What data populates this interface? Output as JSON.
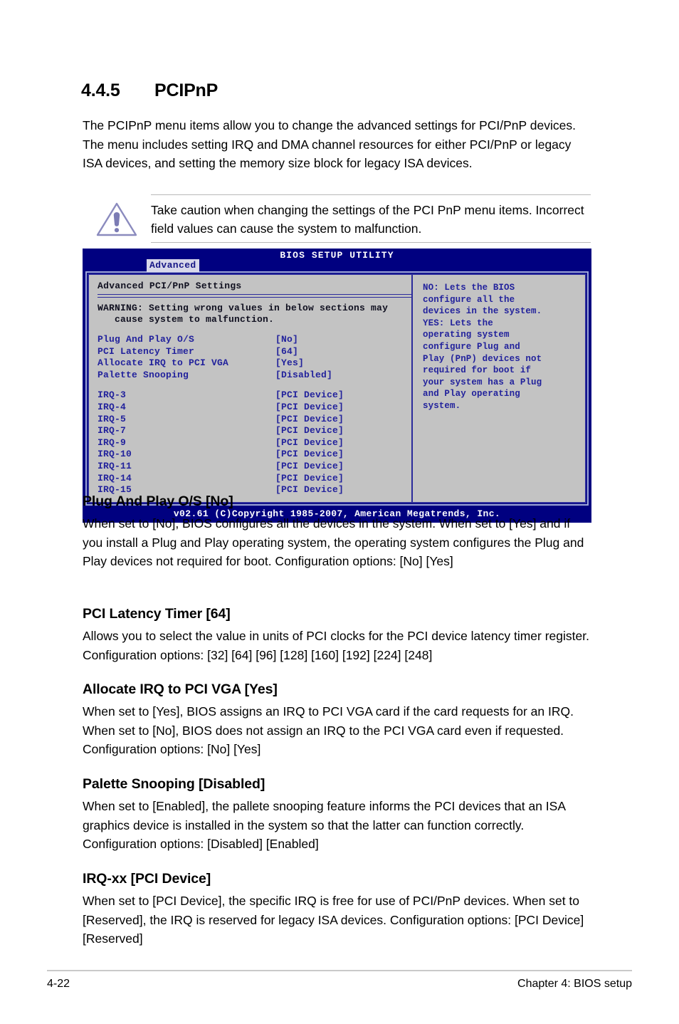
{
  "section": {
    "number": "4.4.5",
    "title": "PCIPnP",
    "intro": "The PCIPnP menu items allow you to change the advanced settings for PCI/PnP devices. The menu includes setting IRQ and DMA channel resources for either PCI/PnP or legacy ISA devices, and setting the memory size block for legacy ISA devices."
  },
  "caution": {
    "icon": "warning-triangle-icon",
    "text": "Take caution when changing the settings of the PCI PnP menu items. Incorrect field values can cause the system to malfunction."
  },
  "bios": {
    "title": "BIOS SETUP UTILITY",
    "active_tab": "Advanced",
    "panel_title": "Advanced PCI/PnP Settings",
    "warning_line1": "WARNING: Setting wrong values in below sections may",
    "warning_line2": "   cause system to malfunction.",
    "settings": [
      {
        "label": "Plug And Play O/S",
        "value": "[No]"
      },
      {
        "label": "PCI Latency Timer",
        "value": "[64]"
      },
      {
        "label": "Allocate IRQ to PCI VGA",
        "value": "[Yes]"
      },
      {
        "label": "Palette Snooping",
        "value": "[Disabled]"
      }
    ],
    "irqs": [
      {
        "label": "IRQ-3",
        "value": "[PCI Device]"
      },
      {
        "label": "IRQ-4",
        "value": "[PCI Device]"
      },
      {
        "label": "IRQ-5",
        "value": "[PCI Device]"
      },
      {
        "label": "IRQ-7",
        "value": "[PCI Device]"
      },
      {
        "label": "IRQ-9",
        "value": "[PCI Device]"
      },
      {
        "label": "IRQ-10",
        "value": "[PCI Device]"
      },
      {
        "label": "IRQ-11",
        "value": "[PCI Device]"
      },
      {
        "label": "IRQ-14",
        "value": "[PCI Device]"
      },
      {
        "label": "IRQ-15",
        "value": "[PCI Device]"
      }
    ],
    "help": "NO: Lets the BIOS\nconfigure all the\ndevices in the system.\nYES: Lets the\noperating system\nconfigure Plug and\nPlay (PnP) devices not\nrequired for boot if\nyour system has a Plug\nand Play operating\nsystem.",
    "footer": "v02.61 (C)Copyright 1985-2007, American Megatrends, Inc.",
    "colors": {
      "header_blue": "#000080",
      "panel_gray": "#c3c3c3",
      "item_blue": "#22229c",
      "tab_highlight": "#d8d8ea"
    }
  },
  "items": [
    {
      "heading": "Plug And Play O/S [No]",
      "body": "When set to [No], BIOS configures all the devices in the system. When set to [Yes] and if you install a Plug and Play operating system, the operating system configures the Plug and Play devices not required for boot. Configuration options: [No] [Yes]"
    },
    {
      "heading": "PCI Latency Timer [64]",
      "body": "Allows you to select the value in units of PCI clocks for the PCI device latency timer register. Configuration options: [32] [64] [96] [128] [160] [192] [224] [248]"
    },
    {
      "heading": "Allocate IRQ to PCI VGA [Yes]",
      "body": "When set to [Yes], BIOS assigns an IRQ to PCI VGA card if the card requests for an IRQ. When set to [No], BIOS does not assign an IRQ to the PCI VGA card even if requested. Configuration options: [No] [Yes]"
    },
    {
      "heading": "Palette Snooping [Disabled]",
      "body": "When set to [Enabled], the pallete snooping feature informs the PCI devices that an ISA graphics device is installed in the system so that the latter can function correctly. Configuration options: [Disabled] [Enabled]"
    },
    {
      "heading": "IRQ-xx [PCI Device]",
      "body": "When set to [PCI Device], the specific IRQ is free for use of PCI/PnP devices. When set to [Reserved], the IRQ is reserved for legacy ISA devices. Configuration options: [PCI Device] [Reserved]"
    }
  ],
  "footer": {
    "page_number": "4-22",
    "chapter": "Chapter 4: BIOS setup"
  }
}
